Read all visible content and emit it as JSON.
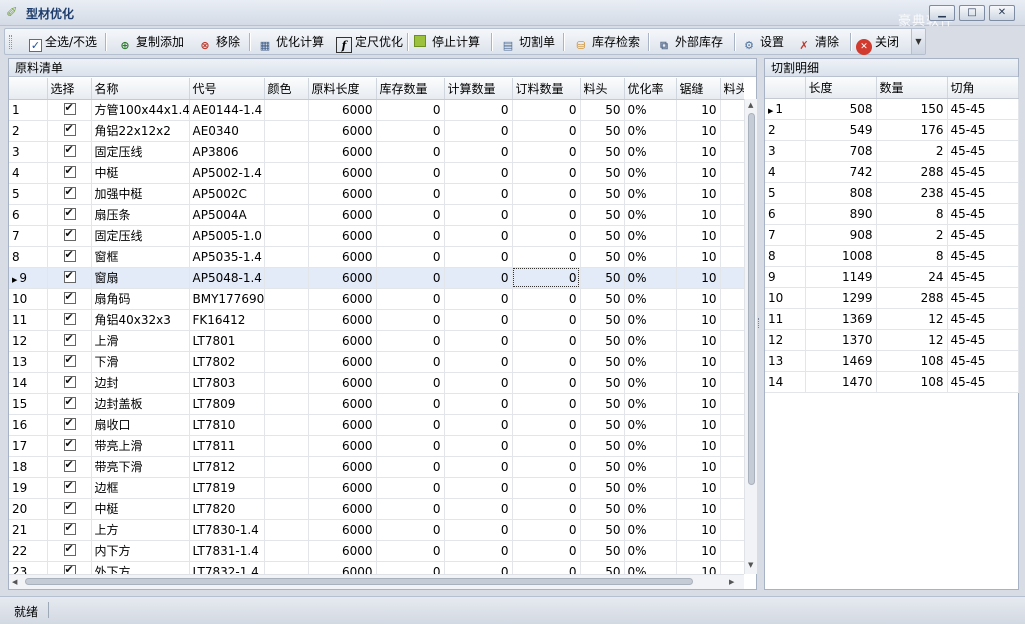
{
  "window": {
    "title": "型材优化",
    "watermark": "豪典软件",
    "buttons": {
      "minimize": "▁",
      "maximize": "□",
      "close": "✕"
    }
  },
  "toolbar": {
    "select_all": "全选/不选",
    "copy_add": "复制添加",
    "remove": "移除",
    "optimize": "优化计算",
    "fixed_length": "定尺优化",
    "stop": "停止计算",
    "cut_list": "切割单",
    "stock_check": "库存检索",
    "external_stock": "外部库存",
    "settings": "设置",
    "clear": "清除",
    "close": "关闭"
  },
  "materials": {
    "title": "原料清单",
    "columns": [
      "",
      "选择",
      "名称",
      "代号",
      "颜色",
      "原料长度",
      "库存数量",
      "计算数量",
      "订料数量",
      "料头",
      "优化率",
      "锯缝",
      "料头"
    ],
    "selected_row": 9,
    "rows": [
      {
        "no": "1",
        "name": "方管100x44x1.4",
        "code": "AE0144-1.4",
        "color": "",
        "length": "6000",
        "stock": "0",
        "calc": "0",
        "order": "0",
        "head": "50",
        "rate": "0%",
        "kerf": "10"
      },
      {
        "no": "2",
        "name": "角铝22x12x2",
        "code": "AE0340",
        "color": "",
        "length": "6000",
        "stock": "0",
        "calc": "0",
        "order": "0",
        "head": "50",
        "rate": "0%",
        "kerf": "10"
      },
      {
        "no": "3",
        "name": "固定压线",
        "code": "AP3806",
        "color": "",
        "length": "6000",
        "stock": "0",
        "calc": "0",
        "order": "0",
        "head": "50",
        "rate": "0%",
        "kerf": "10"
      },
      {
        "no": "4",
        "name": "中梃",
        "code": "AP5002-1.4",
        "color": "",
        "length": "6000",
        "stock": "0",
        "calc": "0",
        "order": "0",
        "head": "50",
        "rate": "0%",
        "kerf": "10"
      },
      {
        "no": "5",
        "name": "加强中梃",
        "code": "AP5002C",
        "color": "",
        "length": "6000",
        "stock": "0",
        "calc": "0",
        "order": "0",
        "head": "50",
        "rate": "0%",
        "kerf": "10"
      },
      {
        "no": "6",
        "name": "扇压条",
        "code": "AP5004A",
        "color": "",
        "length": "6000",
        "stock": "0",
        "calc": "0",
        "order": "0",
        "head": "50",
        "rate": "0%",
        "kerf": "10"
      },
      {
        "no": "7",
        "name": "固定压线",
        "code": "AP5005-1.0",
        "color": "",
        "length": "6000",
        "stock": "0",
        "calc": "0",
        "order": "0",
        "head": "50",
        "rate": "0%",
        "kerf": "10"
      },
      {
        "no": "8",
        "name": "窗框",
        "code": "AP5035-1.4",
        "color": "",
        "length": "6000",
        "stock": "0",
        "calc": "0",
        "order": "0",
        "head": "50",
        "rate": "0%",
        "kerf": "10"
      },
      {
        "no": "9",
        "name": "窗扇",
        "code": "AP5048-1.4",
        "color": "",
        "length": "6000",
        "stock": "0",
        "calc": "0",
        "order": "0",
        "head": "50",
        "rate": "0%",
        "kerf": "10"
      },
      {
        "no": "10",
        "name": "扇角码",
        "code": "BMY177690",
        "color": "",
        "length": "6000",
        "stock": "0",
        "calc": "0",
        "order": "0",
        "head": "50",
        "rate": "0%",
        "kerf": "10"
      },
      {
        "no": "11",
        "name": "角铝40x32x3",
        "code": "FK16412",
        "color": "",
        "length": "6000",
        "stock": "0",
        "calc": "0",
        "order": "0",
        "head": "50",
        "rate": "0%",
        "kerf": "10"
      },
      {
        "no": "12",
        "name": "上滑",
        "code": "LT7801",
        "color": "",
        "length": "6000",
        "stock": "0",
        "calc": "0",
        "order": "0",
        "head": "50",
        "rate": "0%",
        "kerf": "10"
      },
      {
        "no": "13",
        "name": "下滑",
        "code": "LT7802",
        "color": "",
        "length": "6000",
        "stock": "0",
        "calc": "0",
        "order": "0",
        "head": "50",
        "rate": "0%",
        "kerf": "10"
      },
      {
        "no": "14",
        "name": "边封",
        "code": "LT7803",
        "color": "",
        "length": "6000",
        "stock": "0",
        "calc": "0",
        "order": "0",
        "head": "50",
        "rate": "0%",
        "kerf": "10"
      },
      {
        "no": "15",
        "name": "边封盖板",
        "code": "LT7809",
        "color": "",
        "length": "6000",
        "stock": "0",
        "calc": "0",
        "order": "0",
        "head": "50",
        "rate": "0%",
        "kerf": "10"
      },
      {
        "no": "16",
        "name": "扇收口",
        "code": "LT7810",
        "color": "",
        "length": "6000",
        "stock": "0",
        "calc": "0",
        "order": "0",
        "head": "50",
        "rate": "0%",
        "kerf": "10"
      },
      {
        "no": "17",
        "name": "带亮上滑",
        "code": "LT7811",
        "color": "",
        "length": "6000",
        "stock": "0",
        "calc": "0",
        "order": "0",
        "head": "50",
        "rate": "0%",
        "kerf": "10"
      },
      {
        "no": "18",
        "name": "带亮下滑",
        "code": "LT7812",
        "color": "",
        "length": "6000",
        "stock": "0",
        "calc": "0",
        "order": "0",
        "head": "50",
        "rate": "0%",
        "kerf": "10"
      },
      {
        "no": "19",
        "name": "边框",
        "code": "LT7819",
        "color": "",
        "length": "6000",
        "stock": "0",
        "calc": "0",
        "order": "0",
        "head": "50",
        "rate": "0%",
        "kerf": "10"
      },
      {
        "no": "20",
        "name": "中梃",
        "code": "LT7820",
        "color": "",
        "length": "6000",
        "stock": "0",
        "calc": "0",
        "order": "0",
        "head": "50",
        "rate": "0%",
        "kerf": "10"
      },
      {
        "no": "21",
        "name": "上方",
        "code": "LT7830-1.4",
        "color": "",
        "length": "6000",
        "stock": "0",
        "calc": "0",
        "order": "0",
        "head": "50",
        "rate": "0%",
        "kerf": "10"
      },
      {
        "no": "22",
        "name": "内下方",
        "code": "LT7831-1.4",
        "color": "",
        "length": "6000",
        "stock": "0",
        "calc": "0",
        "order": "0",
        "head": "50",
        "rate": "0%",
        "kerf": "10"
      },
      {
        "no": "23",
        "name": "外下方",
        "code": "LT7832-1.4",
        "color": "",
        "length": "6000",
        "stock": "0",
        "calc": "0",
        "order": "0",
        "head": "50",
        "rate": "0%",
        "kerf": "10"
      }
    ]
  },
  "cuts": {
    "title": "切割明细",
    "columns": [
      "",
      "长度",
      "数量",
      "切角"
    ],
    "selected_row": 1,
    "rows": [
      {
        "no": "1",
        "length": "508",
        "qty": "150",
        "angle": "45-45"
      },
      {
        "no": "2",
        "length": "549",
        "qty": "176",
        "angle": "45-45"
      },
      {
        "no": "3",
        "length": "708",
        "qty": "2",
        "angle": "45-45"
      },
      {
        "no": "4",
        "length": "742",
        "qty": "288",
        "angle": "45-45"
      },
      {
        "no": "5",
        "length": "808",
        "qty": "238",
        "angle": "45-45"
      },
      {
        "no": "6",
        "length": "890",
        "qty": "8",
        "angle": "45-45"
      },
      {
        "no": "7",
        "length": "908",
        "qty": "2",
        "angle": "45-45"
      },
      {
        "no": "8",
        "length": "1008",
        "qty": "8",
        "angle": "45-45"
      },
      {
        "no": "9",
        "length": "1149",
        "qty": "24",
        "angle": "45-45"
      },
      {
        "no": "10",
        "length": "1299",
        "qty": "288",
        "angle": "45-45"
      },
      {
        "no": "11",
        "length": "1369",
        "qty": "12",
        "angle": "45-45"
      },
      {
        "no": "12",
        "length": "1370",
        "qty": "12",
        "angle": "45-45"
      },
      {
        "no": "13",
        "length": "1469",
        "qty": "108",
        "angle": "45-45"
      },
      {
        "no": "14",
        "length": "1470",
        "qty": "108",
        "angle": "45-45"
      }
    ]
  },
  "status": {
    "text": "就绪"
  },
  "colors": {
    "accent": "#1d3c6b",
    "selected_row": "#e3ebf8",
    "panel_border": "#a7b3c4"
  },
  "icons": {
    "app": "profile-optimize-icon",
    "select_all": "checkbox-icon",
    "copy_add": "copy-add-icon",
    "remove": "remove-icon",
    "optimize": "calculator-icon",
    "fixed_length": "function-icon",
    "stop": "stop-icon",
    "cut_list": "document-icon",
    "stock_check": "database-icon",
    "external_stock": "external-stock-icon",
    "settings": "gear-icon",
    "clear": "clear-icon",
    "close": "close-icon"
  }
}
